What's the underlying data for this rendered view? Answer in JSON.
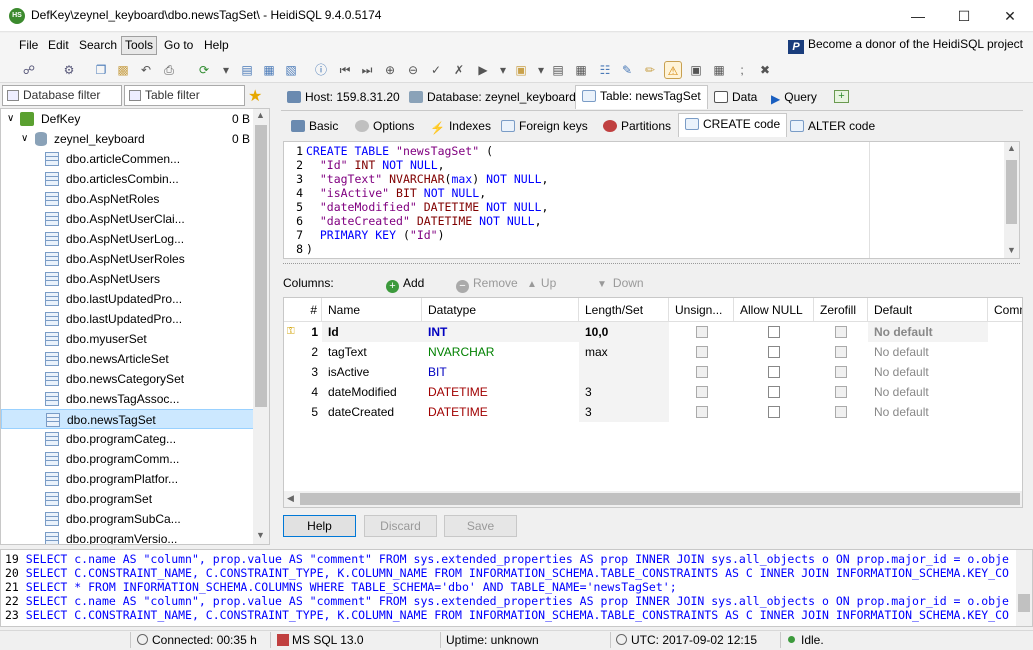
{
  "window": {
    "title": "DefKey\\zeynel_keyboard\\dbo.newsTagSet\\ - HeidiSQL 9.4.0.5174",
    "app_icon": "HS"
  },
  "menu": {
    "items": [
      "File",
      "Edit",
      "Search",
      "Tools",
      "Go to",
      "Help"
    ],
    "donor_label": "Become a donor of the HeidiSQL project"
  },
  "left": {
    "database_filter": "Database filter",
    "table_filter": "Table filter",
    "tree": {
      "root": {
        "label": "DefKey",
        "size": "0 B"
      },
      "database": {
        "label": "zeynel_keyboard",
        "size": "0 B"
      },
      "tables": [
        "dbo.articleCommen...",
        "dbo.articlesCombin...",
        "dbo.AspNetRoles",
        "dbo.AspNetUserClai...",
        "dbo.AspNetUserLog...",
        "dbo.AspNetUserRoles",
        "dbo.AspNetUsers",
        "dbo.lastUpdatedPro...",
        "dbo.lastUpdatedPro...",
        "dbo.myuserSet",
        "dbo.newsArticleSet",
        "dbo.newsCategorySet",
        "dbo.newsTagAssoc...",
        "dbo.newsTagSet",
        "dbo.programCateg...",
        "dbo.programComm...",
        "dbo.programPlatfor...",
        "dbo.programSet",
        "dbo.programSubCa...",
        "dbo.programVersio..."
      ],
      "selected_index": 13
    }
  },
  "main_tabs": [
    "Host: 159.8.31.20",
    "Database: zeynel_keyboard",
    "Table: newsTagSet",
    "Data",
    "Query"
  ],
  "sub_tabs": [
    "Basic",
    "Options",
    "Indexes",
    "Foreign keys",
    "Partitions",
    "CREATE code",
    "ALTER code"
  ],
  "editor": {
    "line_numbers": [
      "1",
      "2",
      "3",
      "4",
      "5",
      "6",
      "7",
      "8"
    ],
    "lines": [
      [
        "CREATE TABLE",
        " ",
        "\"newsTagSet\"",
        " ("
      ],
      [
        "",
        "  ",
        "\"Id\"",
        " INT NOT NULL,"
      ],
      [
        "",
        "  ",
        "\"tagText\"",
        " NVARCHAR(max) NOT NULL,"
      ],
      [
        "",
        "  ",
        "\"isActive\"",
        " BIT NOT NULL,"
      ],
      [
        "",
        "  ",
        "\"dateModified\"",
        " DATETIME NOT NULL,"
      ],
      [
        "",
        "  ",
        "\"dateCreated\"",
        " DATETIME NOT NULL,"
      ],
      [
        "",
        "  ",
        "PRIMARY KEY",
        " (\"Id\")"
      ],
      [
        ")",
        "",
        "",
        ""
      ]
    ]
  },
  "columns_toolbar": {
    "label": "Columns:",
    "add": "Add",
    "remove": "Remove",
    "up": "Up",
    "down": "Down"
  },
  "grid": {
    "headers": [
      "#",
      "Name",
      "Datatype",
      "Length/Set",
      "Unsign...",
      "Allow NULL",
      "Zerofill",
      "Default",
      "Comm"
    ],
    "rows": [
      {
        "num": "1",
        "name": "Id",
        "type": "INT",
        "length": "10,0",
        "default": "No default",
        "type_color": "#0000c0"
      },
      {
        "num": "2",
        "name": "tagText",
        "type": "NVARCHAR",
        "length": "max",
        "default": "No default",
        "type_color": "#008000"
      },
      {
        "num": "3",
        "name": "isActive",
        "type": "BIT",
        "length": "",
        "default": "No default",
        "type_color": "#0000c0"
      },
      {
        "num": "4",
        "name": "dateModified",
        "type": "DATETIME",
        "length": "3",
        "default": "No default",
        "type_color": "#a00000"
      },
      {
        "num": "5",
        "name": "dateCreated",
        "type": "DATETIME",
        "length": "3",
        "default": "No default",
        "type_color": "#a00000"
      }
    ]
  },
  "buttons": {
    "help": "Help",
    "discard": "Discard",
    "save": "Save"
  },
  "log": {
    "lines": [
      {
        "n": "19",
        "text": "SELECT c.name AS \"column\", prop.value AS \"comment\" FROM sys.extended_properties AS prop INNER JOIN sys.all_objects o ON prop.major_id = o.obje"
      },
      {
        "n": "20",
        "text": "SELECT C.CONSTRAINT_NAME, C.CONSTRAINT_TYPE, K.COLUMN_NAME FROM INFORMATION_SCHEMA.TABLE_CONSTRAINTS AS C INNER JOIN INFORMATION_SCHEMA.KEY_CO"
      },
      {
        "n": "21",
        "text": "SELECT * FROM INFORMATION_SCHEMA.COLUMNS WHERE TABLE_SCHEMA='dbo' AND TABLE_NAME='newsTagSet';"
      },
      {
        "n": "22",
        "text": "SELECT c.name AS \"column\", prop.value AS \"comment\" FROM sys.extended_properties AS prop INNER JOIN sys.all_objects o ON prop.major_id = o.obje"
      },
      {
        "n": "23",
        "text": "SELECT C.CONSTRAINT_NAME, C.CONSTRAINT_TYPE, K.COLUMN_NAME FROM INFORMATION_SCHEMA.TABLE_CONSTRAINTS AS C INNER JOIN INFORMATION_SCHEMA.KEY_CO"
      }
    ]
  },
  "status": {
    "connected": "Connected: 00:35 h",
    "server": "MS SQL 13.0",
    "uptime": "Uptime: unknown",
    "utc": "UTC: 2017-09-02 12:15",
    "state": "Idle."
  }
}
